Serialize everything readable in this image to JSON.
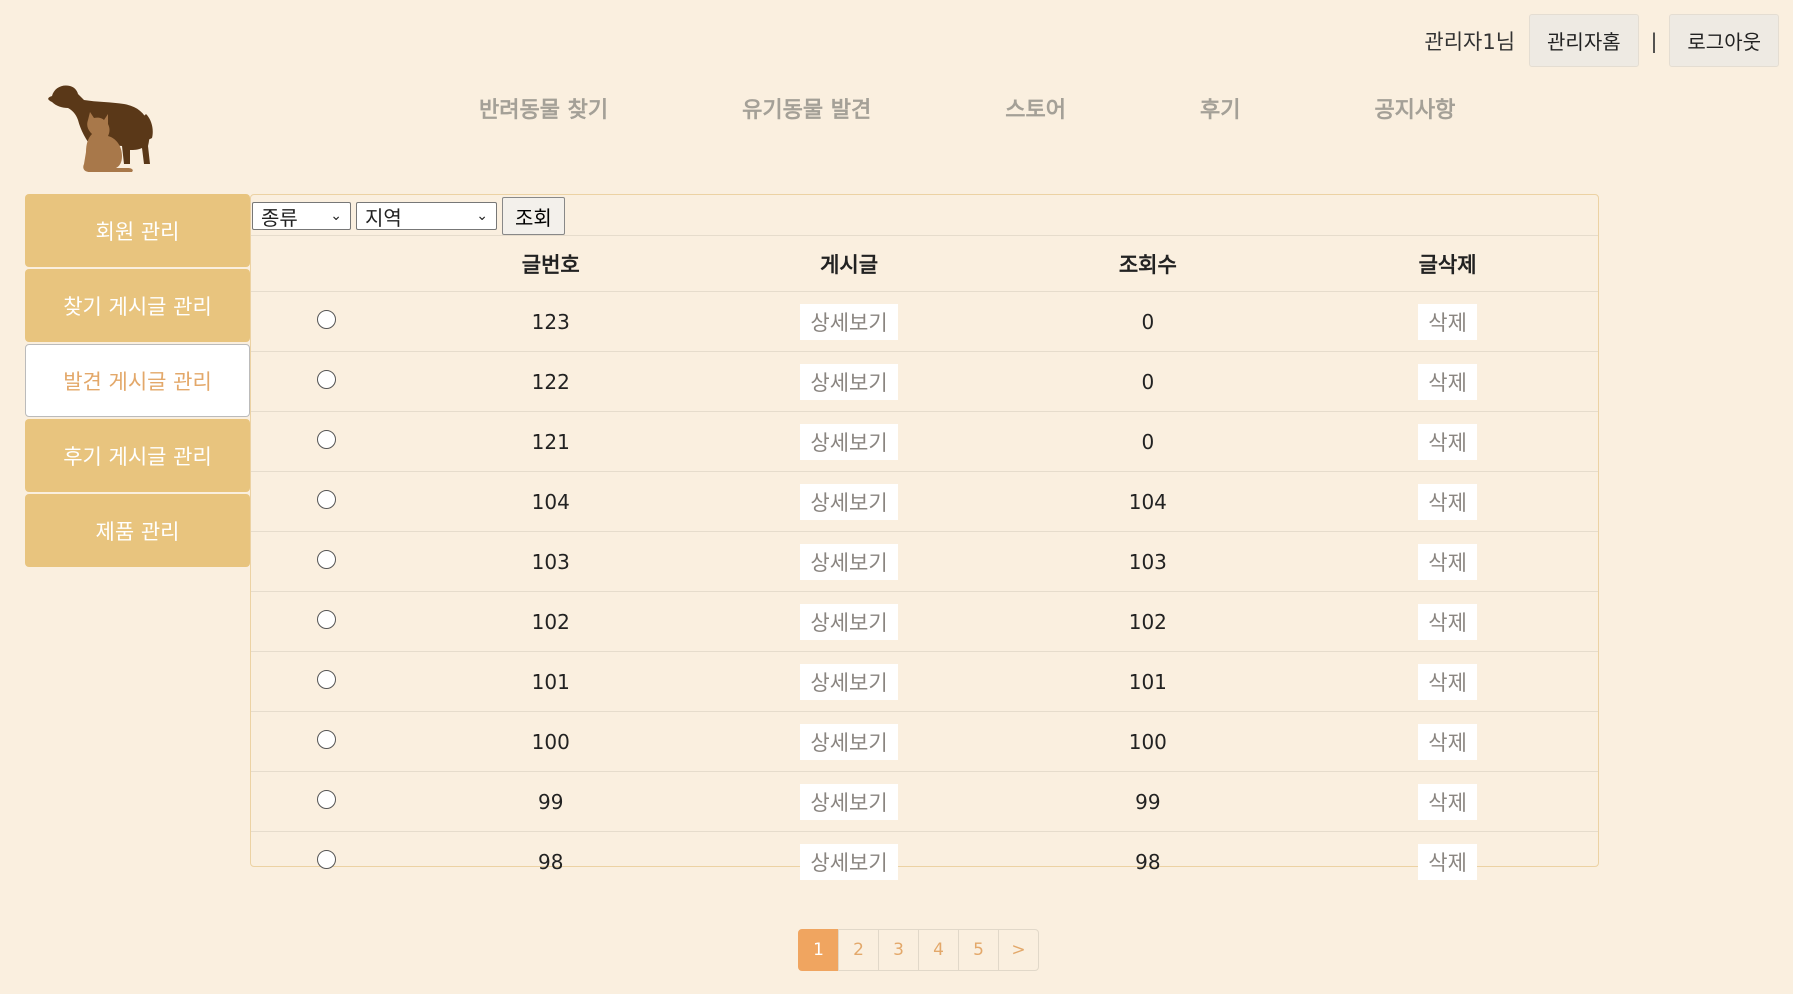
{
  "header": {
    "user_name": "관리자1님",
    "admin_home_label": "관리자홈",
    "separator": "|",
    "logout_label": "로그아웃"
  },
  "nav": {
    "items": [
      {
        "label": "반려동물 찾기"
      },
      {
        "label": "유기동물 발견"
      },
      {
        "label": "스토어"
      },
      {
        "label": "후기"
      },
      {
        "label": "공지사항"
      }
    ]
  },
  "sidebar": {
    "items": [
      {
        "label": "회원 관리",
        "active": false
      },
      {
        "label": "찾기 게시글 관리",
        "active": false
      },
      {
        "label": "발견 게시글 관리",
        "active": true
      },
      {
        "label": "후기 게시글 관리",
        "active": false
      },
      {
        "label": "제품 관리",
        "active": false
      }
    ]
  },
  "filters": {
    "kind_selected": "종류",
    "region_selected": "지역",
    "search_label": "조회"
  },
  "table": {
    "headers": [
      "",
      "글번호",
      "게시글",
      "조회수",
      "글삭제"
    ],
    "detail_label": "상세보기",
    "delete_label": "삭제",
    "rows": [
      {
        "post_no": "123",
        "views": "0"
      },
      {
        "post_no": "122",
        "views": "0"
      },
      {
        "post_no": "121",
        "views": "0"
      },
      {
        "post_no": "104",
        "views": "104"
      },
      {
        "post_no": "103",
        "views": "103"
      },
      {
        "post_no": "102",
        "views": "102"
      },
      {
        "post_no": "101",
        "views": "101"
      },
      {
        "post_no": "100",
        "views": "100"
      },
      {
        "post_no": "99",
        "views": "99"
      },
      {
        "post_no": "98",
        "views": "98"
      }
    ]
  },
  "pagination": {
    "pages": [
      "1",
      "2",
      "3",
      "4",
      "5"
    ],
    "current": "1",
    "next_label": ">"
  },
  "colors": {
    "background": "#faefdf",
    "sidebar": "#e8c47e",
    "accent": "#f0a560",
    "logo_dog": "#5a3818",
    "logo_cat": "#a8784a"
  }
}
